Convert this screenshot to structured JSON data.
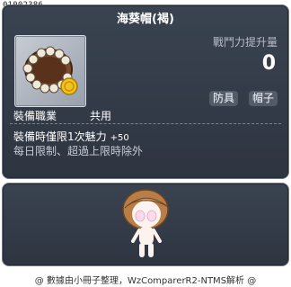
{
  "item_id": "01002386",
  "item": {
    "name": "海葵帽(褐)",
    "icon": "hat-icon"
  },
  "stats": {
    "caption": "戰鬥力提升量",
    "value": "0"
  },
  "tags": [
    "防具",
    "帽子"
  ],
  "job": {
    "label": "裝備職業",
    "value": "共用"
  },
  "effect": {
    "text": "裝備時僅限1次魅力",
    "bonus": "+50"
  },
  "restriction": "每日限制、超過上限時除外",
  "preview": {
    "icon": "character-preview-icon"
  },
  "footer": "@ 數據由小冊子整理，WzComparerR2-NTMS解析 @",
  "colors": {
    "panel_bg": "#343c48",
    "panel_border": "#6d7785",
    "text_primary": "#ffffff",
    "text_muted": "#b6bcc6",
    "tag_bg": "#525b68"
  }
}
